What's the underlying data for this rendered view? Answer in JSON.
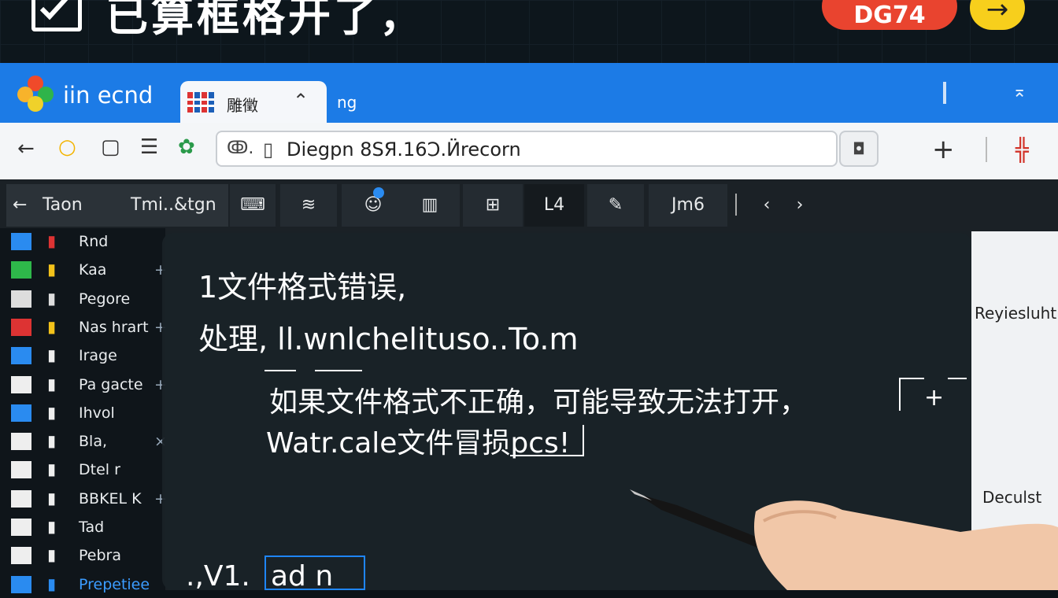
{
  "banner": {
    "title": "已算框格开了，",
    "badge": "DG74",
    "arrow": "→"
  },
  "titlebar": {
    "app_name": "iin ecnd",
    "tab_label": "雕徵",
    "tab2_label": "ng"
  },
  "addressbar": {
    "lock_text": "ↂ.",
    "url": "Diegpn 8SЯ.16Ͻ.Ӥrecorn"
  },
  "toolbar": {
    "back_arrow": "←",
    "back_label": "Taon",
    "back_label2": "Tmi..&tgn",
    "btn_l4": "L4",
    "btn_jm6": "Jm6"
  },
  "sidebar": {
    "items": [
      {
        "label": "Rnd",
        "extra": ""
      },
      {
        "label": "Kaa",
        "extra": "+ ▪"
      },
      {
        "label": "Pegore",
        "extra": ""
      },
      {
        "label": "Nas hrart",
        "extra": "+ ▪"
      },
      {
        "label": "Irage",
        "extra": ""
      },
      {
        "label": "Pa gacte",
        "extra": "+ ▪"
      },
      {
        "label": "Ihvol",
        "extra": ""
      },
      {
        "label": "Bla, ",
        "extra": "× ▪"
      },
      {
        "label": "Dtel r",
        "extra": ""
      },
      {
        "label": "BBKEL K",
        "extra": "+ ▪"
      },
      {
        "label": "Tad",
        "extra": ""
      },
      {
        "label": "Pebra",
        "extra": ""
      },
      {
        "label": "Prepetiee",
        "extra": ""
      }
    ]
  },
  "background": {
    "right_label1": "Reyiesluht",
    "right_label2": "Deculst"
  },
  "dialog": {
    "line1": "1文件格式错误,",
    "line2": "处理, ll.wnlchelituso..To.m",
    "line3": "如果文件格式不正确，可能导致无法打开，",
    "line4": "Watr.cale文件冒损pcs!"
  },
  "bottom": {
    "left_text": ".,V1.",
    "box_text": "ad  n"
  },
  "colors": {
    "titlebar": "#1c7be6",
    "badge": "#e9442f",
    "arrow_button": "#f7cf1c"
  }
}
